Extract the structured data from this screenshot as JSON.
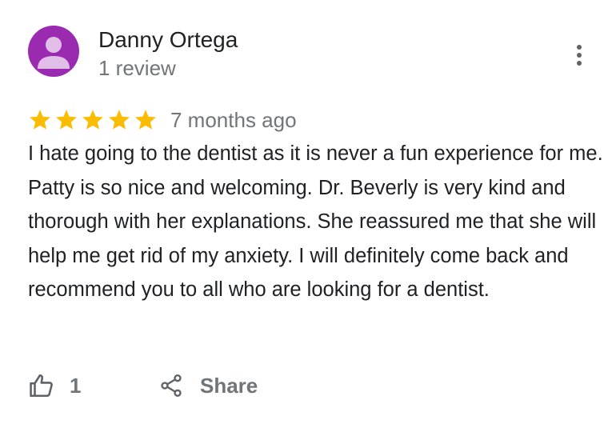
{
  "review": {
    "author_name": "Danny Ortega",
    "review_count": "1 review",
    "rating": 5,
    "max_rating": 5,
    "time_ago": "7 months ago",
    "text": "I hate going to the dentist as it is never a fun experience for me. Patty is so nice and welcoming. Dr. Beverly is very kind and thorough with her explanations. She reassured me that she will help me get rid of my anxiety. I will definitely come back and recommend you to all who are looking for a dentist.",
    "like_count": "1",
    "share_label": "Share"
  },
  "icons": {
    "avatar": "default-person-avatar",
    "menu": "more-vert-icon",
    "star": "star-icon",
    "like": "thumb-up-icon",
    "share": "share-icon"
  },
  "colors": {
    "avatar_bg": "#9a2ab0",
    "avatar_figure": "#e1bee7",
    "star": "#fbbc04",
    "text_primary": "#202124",
    "text_secondary": "#70757a"
  }
}
